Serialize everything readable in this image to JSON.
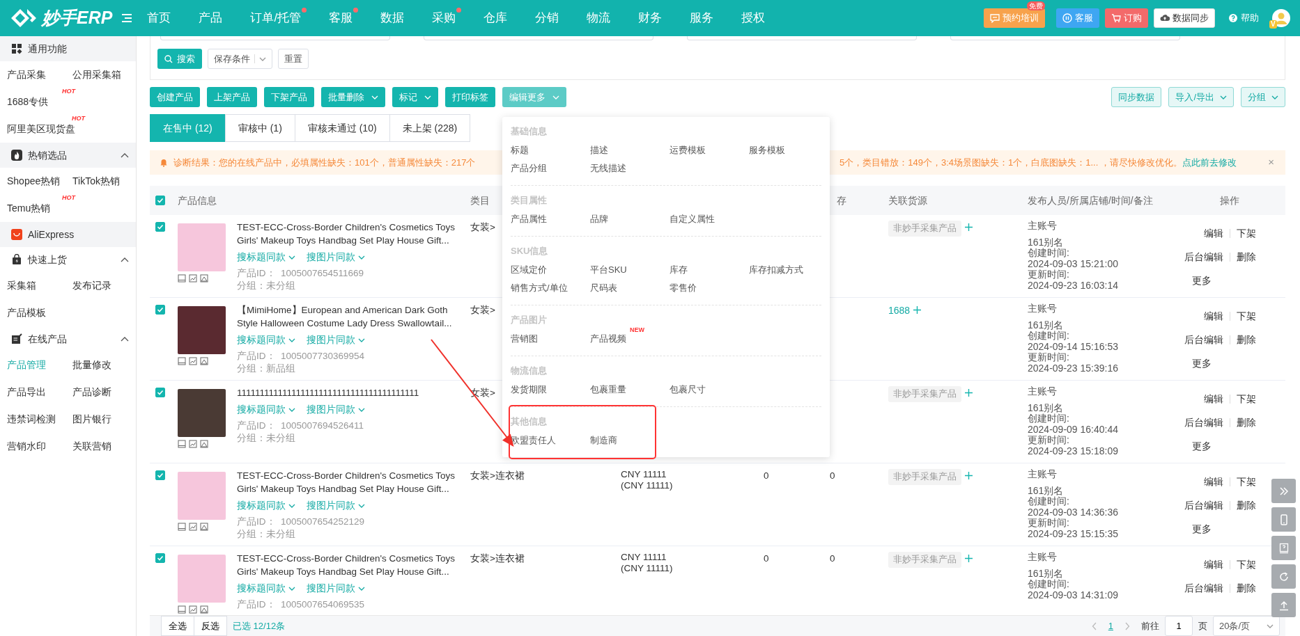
{
  "topbar": {
    "logo": "妙手ERP",
    "nav": [
      {
        "label": "首页",
        "dot": false
      },
      {
        "label": "产品",
        "dot": false
      },
      {
        "label": "订单/托管",
        "dot": true
      },
      {
        "label": "客服",
        "dot": true
      },
      {
        "label": "数据",
        "dot": false
      },
      {
        "label": "采购",
        "dot": true
      },
      {
        "label": "仓库",
        "dot": false
      },
      {
        "label": "分销",
        "dot": false
      },
      {
        "label": "物流",
        "dot": false
      },
      {
        "label": "财务",
        "dot": false
      },
      {
        "label": "服务",
        "dot": false
      },
      {
        "label": "授权",
        "dot": false
      }
    ],
    "actions": [
      {
        "kind": "training",
        "label": "预约培训",
        "badge": "免费"
      },
      {
        "kind": "service",
        "label": "客服"
      },
      {
        "kind": "order",
        "label": "订购"
      },
      {
        "kind": "sync",
        "label": "数据同步"
      },
      {
        "kind": "help",
        "label": "帮助"
      }
    ],
    "avatar_badge": "V"
  },
  "sidebar": {
    "sections": [
      {
        "kind": "general",
        "title": "通用功能",
        "shaded": true,
        "rows": [
          [
            {
              "label": "产品采集",
              "selected": false
            },
            {
              "label": "公用采集箱",
              "selected": false
            }
          ],
          [
            {
              "label": "1688专供",
              "selected": false,
              "badge": "HOT"
            }
          ],
          [
            {
              "label": "阿里美区现货盘",
              "selected": false,
              "badge": "HOT"
            }
          ]
        ]
      },
      {
        "kind": "hot",
        "title": "热销选品",
        "shaded": true,
        "expanded": true,
        "rows": [
          [
            {
              "label": "Shopee热销",
              "selected": false
            },
            {
              "label": "TikTok热销",
              "selected": false
            }
          ],
          [
            {
              "label": "Temu热销",
              "selected": false,
              "badge": "HOT"
            }
          ]
        ]
      },
      {
        "kind": "aliexpress",
        "title": "AliExpress",
        "shaded": true
      },
      {
        "kind": "quick",
        "title": "快速上货",
        "shaded": false,
        "expanded": true,
        "rows": [
          [
            {
              "label": "采集箱",
              "selected": false
            },
            {
              "label": "发布记录",
              "selected": false
            }
          ],
          [
            {
              "label": "产品模板",
              "selected": false
            }
          ]
        ]
      },
      {
        "kind": "online",
        "title": "在线产品",
        "shaded": false,
        "expanded": true,
        "rows": [
          [
            {
              "label": "产品管理",
              "selected": true
            },
            {
              "label": "批量修改",
              "selected": false
            }
          ],
          [
            {
              "label": "产品导出",
              "selected": false
            },
            {
              "label": "产品诊断",
              "selected": false
            }
          ],
          [
            {
              "label": "违禁词检测",
              "selected": false
            },
            {
              "label": "图片银行",
              "selected": false
            }
          ],
          [
            {
              "label": "营销水印",
              "selected": false
            },
            {
              "label": "关联营销",
              "selected": false
            }
          ]
        ]
      }
    ]
  },
  "filter": {
    "search": "搜索",
    "save": "保存条件",
    "reset": "重置"
  },
  "toolbar": {
    "left": [
      {
        "label": "创建产品",
        "caret": false,
        "expanded": false
      },
      {
        "label": "上架产品",
        "caret": false,
        "expanded": false
      },
      {
        "label": "下架产品",
        "caret": false,
        "expanded": false
      },
      {
        "label": "批量删除",
        "caret": true,
        "expanded": false
      },
      {
        "label": "标记",
        "caret": true,
        "expanded": false
      },
      {
        "label": "打印标签",
        "caret": false,
        "expanded": false
      },
      {
        "label": "编辑更多",
        "caret": true,
        "expanded": true
      }
    ],
    "right": [
      {
        "label": "同步数据",
        "caret": false
      },
      {
        "label": "导入/导出",
        "caret": true
      },
      {
        "label": "分组",
        "caret": true
      }
    ]
  },
  "edit_menu": {
    "sections": [
      {
        "title": "基础信息",
        "annotated": false,
        "items": [
          {
            "label": "标题"
          },
          {
            "label": "描述"
          },
          {
            "label": "运费模板"
          },
          {
            "label": "服务模板"
          },
          {
            "label": "产品分组"
          },
          {
            "label": "无线描述"
          }
        ]
      },
      {
        "title": "类目属性",
        "annotated": false,
        "items": [
          {
            "label": "产品属性"
          },
          {
            "label": "品牌"
          },
          {
            "label": "自定义属性"
          }
        ]
      },
      {
        "title": "SKU信息",
        "annotated": false,
        "items": [
          {
            "label": "区域定价"
          },
          {
            "label": "平台SKU"
          },
          {
            "label": "库存"
          },
          {
            "label": "库存扣减方式"
          },
          {
            "label": "销售方式/单位"
          },
          {
            "label": "尺码表"
          },
          {
            "label": "零售价"
          }
        ]
      },
      {
        "title": "产品图片",
        "annotated": false,
        "items": [
          {
            "label": "营销图"
          },
          {
            "label": "产品视频",
            "badge": "NEW"
          }
        ]
      },
      {
        "title": "物流信息",
        "annotated": false,
        "items": [
          {
            "label": "发货期限"
          },
          {
            "label": "包裹重量"
          },
          {
            "label": "包裹尺寸"
          }
        ]
      },
      {
        "title": "其他信息",
        "annotated": true,
        "items": [
          {
            "label": "欧盟责任人"
          },
          {
            "label": "制造商"
          }
        ]
      }
    ]
  },
  "tabs": [
    {
      "label": "在售中 (12)",
      "selected": true
    },
    {
      "label": "审核中 (1)",
      "selected": false
    },
    {
      "label": "审核未通过 (10)",
      "selected": false
    },
    {
      "label": "未上架 (228)",
      "selected": false
    }
  ],
  "diagnosis": {
    "text_before": "诊断结果：您的在线产品中，必填属性缺失：101个，普通属性缺失：217个",
    "text_after": "5个，类目错放：149个，3:4场景图缺失：1个，白底图缺失：1... ，请尽快修改优化。",
    "link": "点此前去修改",
    "close": "×"
  },
  "table": {
    "all_checked": true,
    "columns": [
      null,
      "产品信息",
      "类目",
      null,
      null,
      "存",
      "关联货源",
      "发布人员/所属店铺/时间/备注",
      "操作"
    ],
    "rows": [
      {
        "checked": true,
        "title": "TEST-ECC-Cross-Border Children's Cosmetics Toys Girls' Makeup Toys Handbag Set Play House Gift...",
        "search_title": "搜标题同款",
        "search_image": "搜图片同款",
        "product_id": "产品ID：  1005007654511669",
        "group": "分组：未分组",
        "category": "女装>",
        "source": {
          "kind": "tag",
          "label": "非妙手采集产品"
        },
        "publisher": "主账号",
        "alias": "161别名",
        "created_label": "创建时间:",
        "created": "2024-09-03 15:21:00",
        "updated_label": "更新时间:",
        "updated": "2024-09-23 16:03:14",
        "actions": [
          "编辑",
          "下架",
          "后台编辑",
          "删除",
          "更多"
        ]
      },
      {
        "checked": true,
        "title": "【MimiHome】European and American Dark Goth Style Halloween Costume Lady Dress Swallowtail...",
        "search_title": "搜标题同款",
        "search_image": "搜图片同款",
        "product_id": "产品ID：  1005007730369954",
        "group": "分组：新品组",
        "category": "女装>",
        "source": {
          "kind": "link",
          "label": "1688"
        },
        "publisher": "主账号",
        "alias": "161别名",
        "created_label": "创建时间:",
        "created": "2024-09-14 15:16:53",
        "updated_label": "更新时间:",
        "updated": "2024-09-23 15:39:16",
        "actions": [
          "编辑",
          "下架",
          "后台编辑",
          "删除",
          "更多"
        ]
      },
      {
        "checked": true,
        "title": "1111111111111111111111111111111111111111",
        "search_title": "搜标题同款",
        "search_image": "搜图片同款",
        "product_id": "产品ID：  1005007694526411",
        "group": "分组：未分组",
        "category": "女装>",
        "source": {
          "kind": "tag",
          "label": "非妙手采集产品"
        },
        "publisher": "主账号",
        "alias": "161别名",
        "created_label": "创建时间:",
        "created": "2024-09-09 16:40:44",
        "updated_label": "更新时间:",
        "updated": "2024-09-23 15:18:09",
        "actions": [
          "编辑",
          "下架",
          "后台编辑",
          "删除",
          "更多"
        ]
      },
      {
        "checked": true,
        "title": "TEST-ECC-Cross-Border Children's Cosmetics Toys Girls' Makeup Toys Handbag Set Play House Gift...",
        "search_title": "搜标题同款",
        "search_image": "搜图片同款",
        "product_id": "产品ID：  1005007654252129",
        "group": "分组：未分组",
        "category": "女装>连衣裙",
        "price": "CNY 11111",
        "price_note": "(CNY 11111)",
        "column_5": "0",
        "stock": "0",
        "source": {
          "kind": "tag",
          "label": "非妙手采集产品"
        },
        "publisher": "主账号",
        "alias": "161别名",
        "created_label": "创建时间:",
        "created": "2024-09-03 14:36:36",
        "updated_label": "更新时间:",
        "updated": "2024-09-23 15:15:35",
        "actions": [
          "编辑",
          "下架",
          "后台编辑",
          "删除",
          "更多"
        ]
      },
      {
        "checked": true,
        "title": "TEST-ECC-Cross-Border Children's Cosmetics Toys Girls' Makeup Toys Handbag Set Play House Gift...",
        "search_title": "搜标题同款",
        "search_image": "搜图片同款",
        "product_id": "产品ID：  1005007654069535",
        "category": "女装>连衣裙",
        "price": "CNY 11111",
        "price_note": "(CNY 11111)",
        "column_5": "0",
        "stock": "0",
        "source": {
          "kind": "tag",
          "label": "非妙手采集产品"
        },
        "publisher": "主账号",
        "alias": "161别名",
        "created_label": "创建时间:",
        "created": "2024-09-03 14:31:09",
        "actions": [
          "编辑",
          "下架",
          "后台编辑",
          "删除"
        ]
      }
    ]
  },
  "footer": {
    "select_all": "全选",
    "invert": "反选",
    "selected": "已选 12/12条",
    "page": "1",
    "goto": "前往",
    "goto_value": "1",
    "page_unit": "页",
    "page_size": "20条/页"
  }
}
